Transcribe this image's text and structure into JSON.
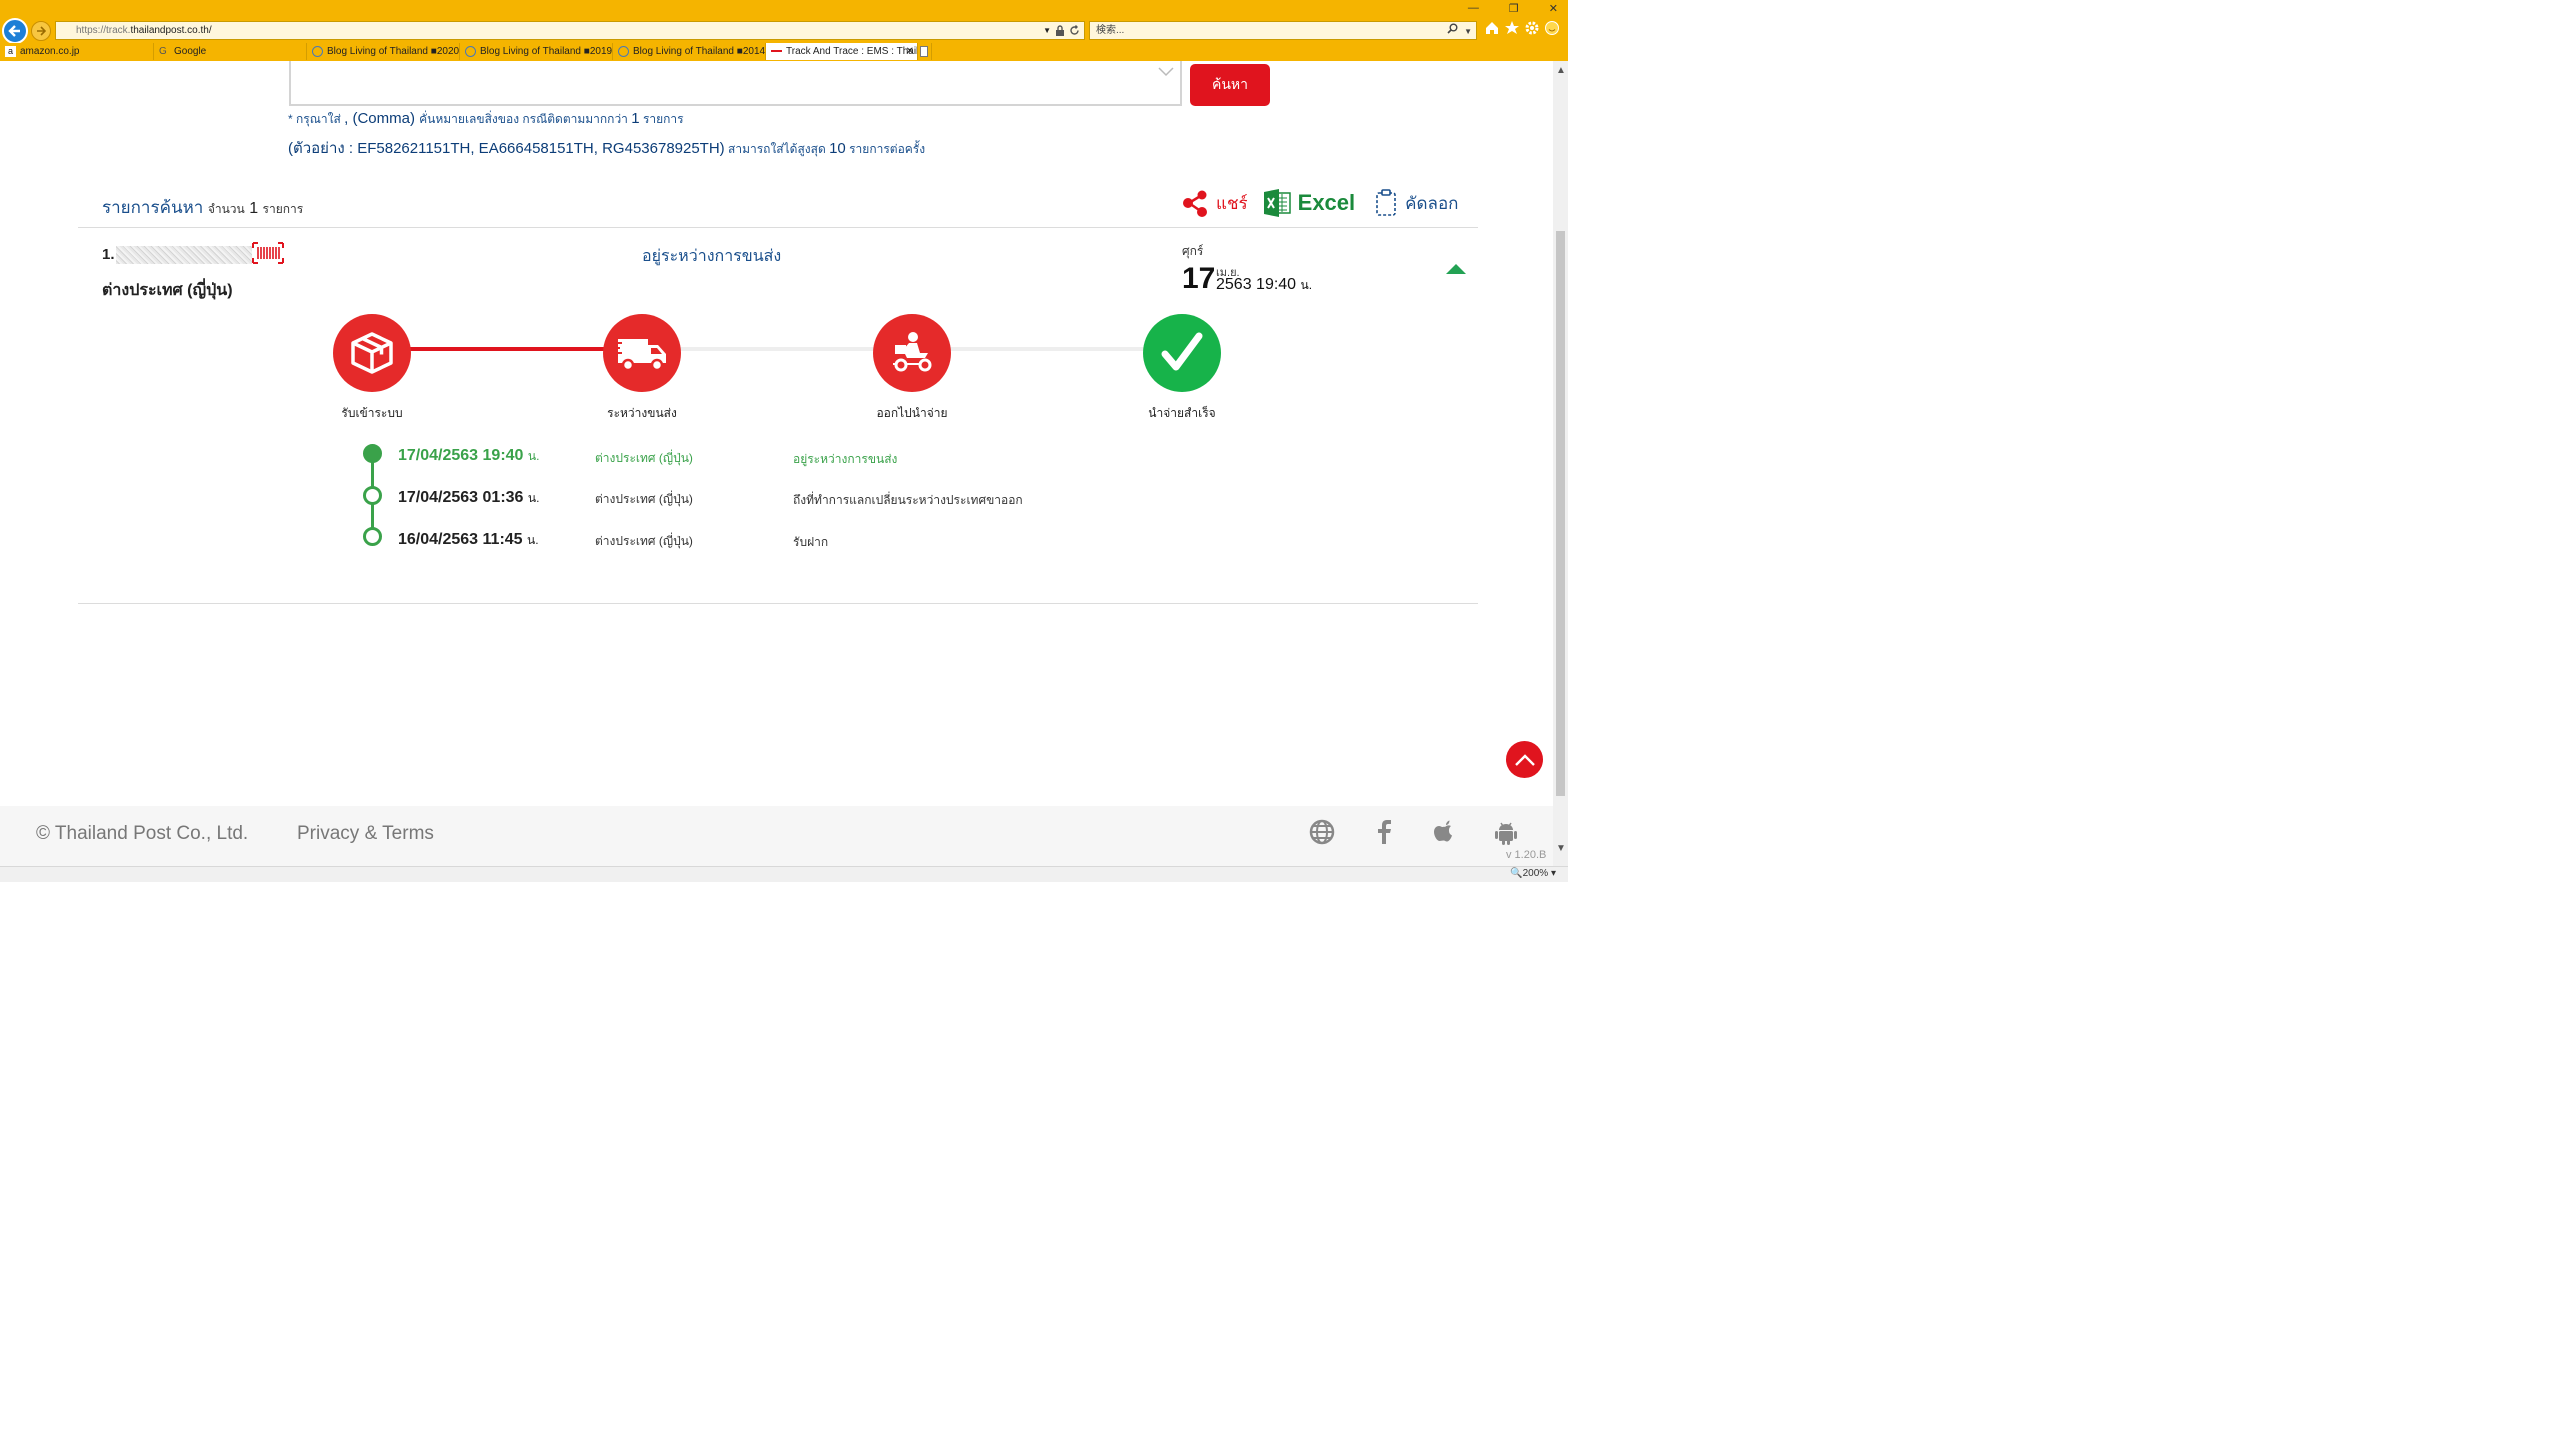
{
  "browser": {
    "url_scheme": "https://track.",
    "url_host": "thailandpost.co.th/",
    "search_placeholder": "検索...",
    "tabs": [
      {
        "label": "amazon.co.jp"
      },
      {
        "label": "Google"
      },
      {
        "label": "Blog Living of Thailand ■2020..."
      },
      {
        "label": "Blog Living of Thailand ■2019..."
      },
      {
        "label": "Blog Living of Thailand ■2014..."
      },
      {
        "label": "Track And Trace : EMS : Thail...",
        "active": true
      }
    ],
    "zoom": "200%"
  },
  "search": {
    "button_label": "ค้นหา",
    "hint1_a": "* ",
    "hint1_b": "กรุณาใส่ ",
    "hint1_c": ", (Comma) ",
    "hint1_d": "คั่นหมายเลขสิ่งของ กรณีติดตามมากกว่า ",
    "hint1_e": "1",
    "hint1_f": " รายการ",
    "hint2_a": "(ตัวอย่าง : ",
    "hint2_b": "EF582621151TH, EA666458151TH, RG453678925TH)",
    "hint2_c": " สามารถใส่ได้สูงสุด ",
    "hint2_d": "10",
    "hint2_e": " รายการต่อครั้ง"
  },
  "results": {
    "title": "รายการค้นหา",
    "count_prefix": "จำนวน",
    "count": "1",
    "count_suffix": "รายการ",
    "share_label": "แชร์",
    "excel_label": "Excel",
    "copy_label": "คัดลอก"
  },
  "item": {
    "index": "1.",
    "origin": "ต่างประเทศ (ญี่ปุ่น)",
    "status": "อยู่ระหว่างการขนส่ง",
    "day_name": "ศุกร์",
    "day": "17",
    "month": "เม.ย.",
    "year_time": "2563 19:40",
    "time_unit": "น."
  },
  "stages": [
    {
      "label": "รับเข้าระบบ",
      "icon": "box-icon",
      "color": "#e52a2a"
    },
    {
      "label": "ระหว่างขนส่ง",
      "icon": "truck-icon",
      "color": "#e52a2a"
    },
    {
      "label": "ออกไปนำจ่าย",
      "icon": "scooter-icon",
      "color": "#e52a2a"
    },
    {
      "label": "นำจ่ายสำเร็จ",
      "icon": "check-icon",
      "color": "#17b34a"
    }
  ],
  "timeline": [
    {
      "date": "17/04/2563 19:40",
      "unit": "น.",
      "location": "ต่างประเทศ (ญี่ปุ่น)",
      "description": "อยู่ระหว่างการขนส่ง",
      "current": true
    },
    {
      "date": "17/04/2563 01:36",
      "unit": "น.",
      "location": "ต่างประเทศ (ญี่ปุ่น)",
      "description": "ถึงที่ทำการแลกเปลี่ยนระหว่างประเทศขาออก",
      "current": false
    },
    {
      "date": "16/04/2563 11:45",
      "unit": "น.",
      "location": "ต่างประเทศ (ญี่ปุ่น)",
      "description": "รับฝาก",
      "current": false
    }
  ],
  "footer": {
    "copyright": "© Thailand Post Co., Ltd.",
    "privacy": "Privacy & Terms",
    "version": "v 1.20.B"
  },
  "colors": {
    "brand_red": "#e0141e",
    "success_green": "#3aa24a",
    "chrome_yellow": "#f5b400",
    "link_blue": "#1a4f8c"
  }
}
